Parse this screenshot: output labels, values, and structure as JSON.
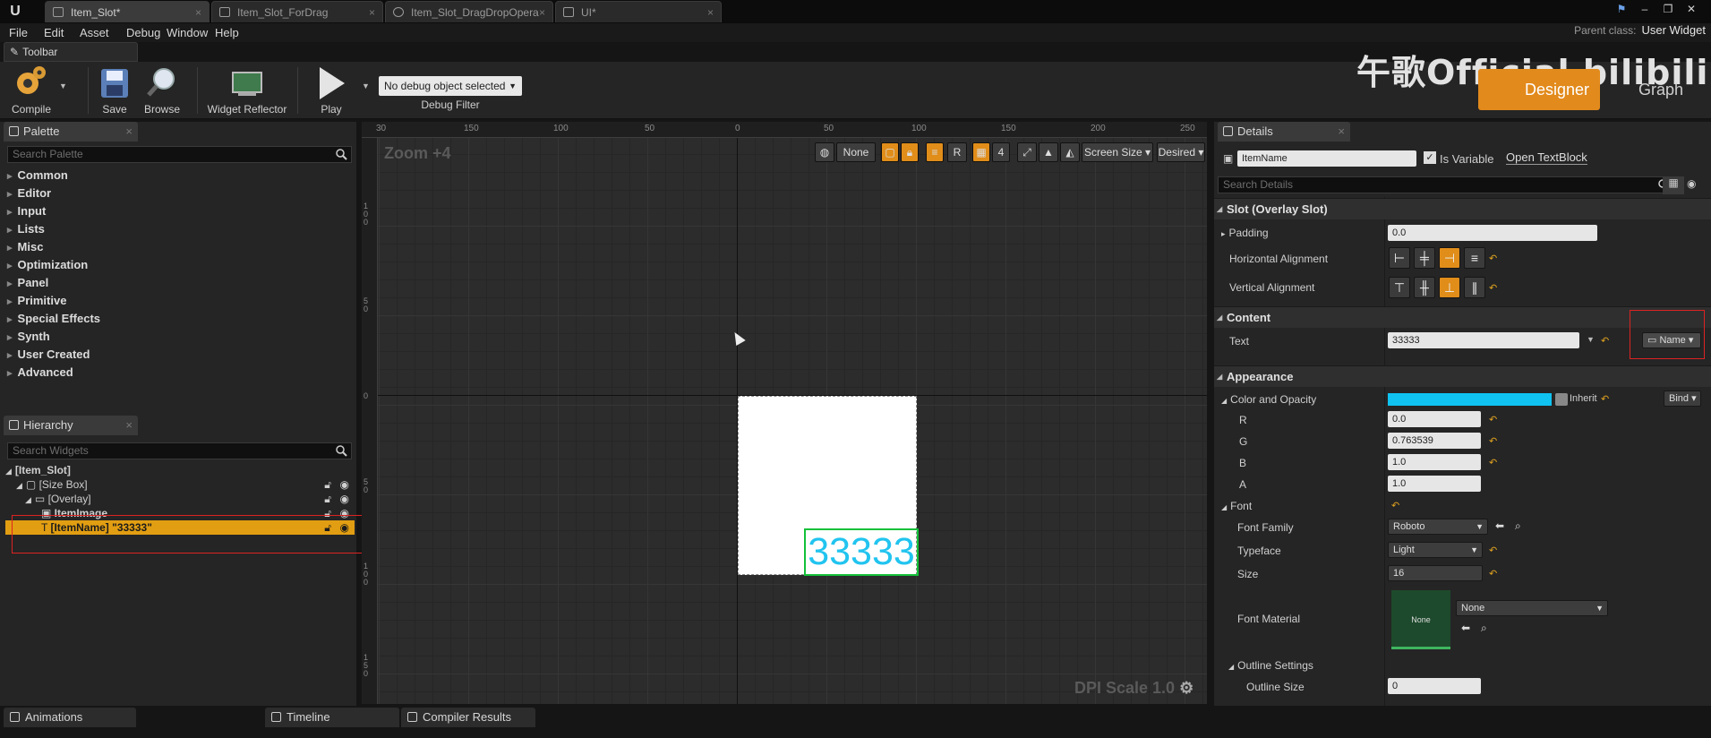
{
  "tabs": [
    {
      "label": "Item_Slot*",
      "active": true
    },
    {
      "label": "Item_Slot_ForDrag",
      "active": false
    },
    {
      "label": "Item_Slot_DragDropOpera",
      "active": false
    },
    {
      "label": "UI*",
      "active": false
    }
  ],
  "menu": [
    "File",
    "Edit",
    "Asset",
    "Debug",
    "Window",
    "Help"
  ],
  "parent_class": {
    "label": "Parent class:",
    "value": "User Widget"
  },
  "toolbar": {
    "tab_label": "Toolbar",
    "compile": "Compile",
    "save": "Save",
    "browse": "Browse",
    "widget_reflector": "Widget Reflector",
    "play": "Play",
    "debug_object": "No debug object selected",
    "debug_filter": "Debug Filter"
  },
  "watermark": "午歌Official bilibili",
  "mode": {
    "designer": "Designer",
    "graph": "Graph"
  },
  "palette": {
    "title": "Palette",
    "search_placeholder": "Search Palette",
    "items": [
      "Common",
      "Editor",
      "Input",
      "Lists",
      "Misc",
      "Optimization",
      "Panel",
      "Primitive",
      "Special Effects",
      "Synth",
      "User Created",
      "Advanced"
    ]
  },
  "hierarchy": {
    "title": "Hierarchy",
    "search_placeholder": "Search Widgets",
    "rows": [
      {
        "label": "[Item_Slot]",
        "depth": 0
      },
      {
        "label": "[Size Box]",
        "depth": 1
      },
      {
        "label": "[Overlay]",
        "depth": 2
      },
      {
        "label": "ItemImage",
        "depth": 3
      },
      {
        "label": "[ItemName] \"33333\"",
        "depth": 3,
        "selected": true
      }
    ]
  },
  "viewport": {
    "zoom": "Zoom +4",
    "dpi": "DPI Scale 1.0",
    "text_preview": "33333",
    "ruler_top": [
      "30",
      "150",
      "100",
      "50",
      "0",
      "50",
      "100",
      "150",
      "200",
      "250"
    ],
    "ruler_left": [
      "1 0 0",
      "5 0",
      "0",
      "5 0",
      "1 0 0",
      "1 5 0"
    ],
    "toolbar": {
      "none": "None",
      "r": "R",
      "four": "4",
      "screen_size": "Screen Size",
      "desired": "Desired"
    }
  },
  "details": {
    "title": "Details",
    "name_value": "ItemName",
    "is_variable": "Is Variable",
    "open_textblock": "Open TextBlock",
    "search_placeholder": "Search Details",
    "slot_section": "Slot (Overlay Slot)",
    "padding_label": "Padding",
    "padding_value": "0.0",
    "h_align_label": "Horizontal Alignment",
    "v_align_label": "Vertical Alignment",
    "content_section": "Content",
    "text_label": "Text",
    "text_value": "33333",
    "name_btn": "Name",
    "appearance_section": "Appearance",
    "color_label": "Color and Opacity",
    "inherit": "Inherit",
    "bind": "Bind",
    "color_hex": "#0fc2f0",
    "r_label": "R",
    "r_value": "0.0",
    "g_label": "G",
    "g_value": "0.763539",
    "b_label": "B",
    "b_value": "1.0",
    "a_label": "A",
    "a_value": "1.0",
    "font_label": "Font",
    "font_family_label": "Font Family",
    "font_family_value": "Roboto",
    "typeface_label": "Typeface",
    "typeface_value": "Light",
    "size_label": "Size",
    "size_value": "16",
    "font_material_label": "Font Material",
    "font_material_value": "None",
    "font_material_thumb": "None",
    "outline_label": "Outline Settings",
    "outline_size_label": "Outline Size",
    "outline_size_value": "0"
  },
  "bottom_tabs": [
    "Animations",
    "Timeline",
    "Compiler Results"
  ]
}
